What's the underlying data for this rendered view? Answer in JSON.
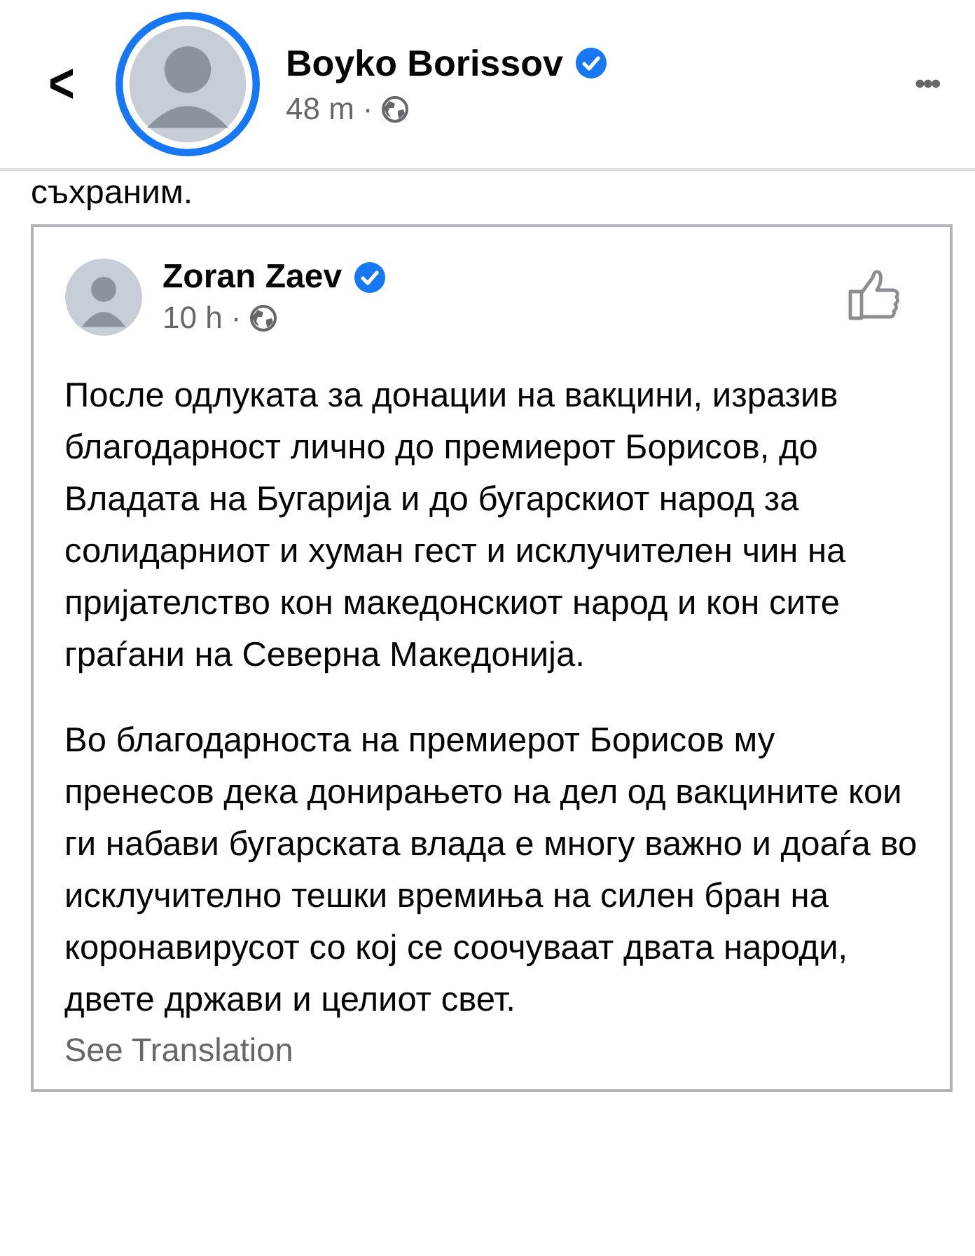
{
  "header": {
    "back": "<",
    "author": "Boyko Borissov",
    "verified": true,
    "time": "48 m",
    "separator": "·",
    "more": "•••"
  },
  "post_text_tail": "съхраним.",
  "shared_post": {
    "author": "Zoran Zaev",
    "verified": true,
    "time": "10 h",
    "separator": "·",
    "paragraphs": [
      "После одлуката за донации на вакцини, изразив благодарност лично до премиерот Борисов, до Владата на Бугарија и до бугарскиот народ за солидарниот и хуман гест и исклучителен чин на пријателство кон македонскиот народ и кон сите граѓани на Северна Македонија.",
      "Во благодарноста на премиерот Борисов му пренесов дека донирањето на дел од вакцините кои ги набави бугарската влада е многу важно и доаѓа во исклучително тешки времиња на силен бран на коронавирусот со кој се соочуваат двата народи, двете држави и целиот свет."
    ],
    "see_translation": "See Translation"
  }
}
